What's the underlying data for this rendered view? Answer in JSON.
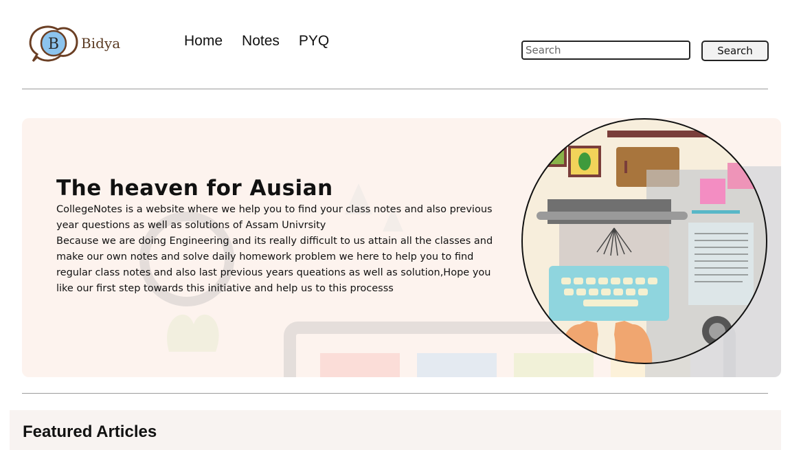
{
  "brand": {
    "logo_letter": "B",
    "name": "Bidya"
  },
  "nav": {
    "items": [
      {
        "label": "Home"
      },
      {
        "label": "Notes"
      },
      {
        "label": "PYQ"
      }
    ]
  },
  "search": {
    "placeholder": "Search",
    "button_label": "Search"
  },
  "hero": {
    "title": "The heaven for Ausian",
    "paragraph_1": "CollegeNotes is a website where we help you to find your class notes and also previous year questions as well as solutions of Assam Univrsity",
    "paragraph_2": "Because we are doing Engineering and its really difficult to us attain all the classes and make our own notes and solve daily homework problem we here to help you to find regular class notes and also last previous years queations as well as solution,Hope you like our first step towards this initiative and help us to this processs"
  },
  "featured": {
    "title": "Featured Articles"
  },
  "colors": {
    "hero_bg": "#fdf3ee",
    "logo_ring": "#6b3f24",
    "logo_fill": "#8cc4ee",
    "featured_bg": "#f8f3f1"
  }
}
